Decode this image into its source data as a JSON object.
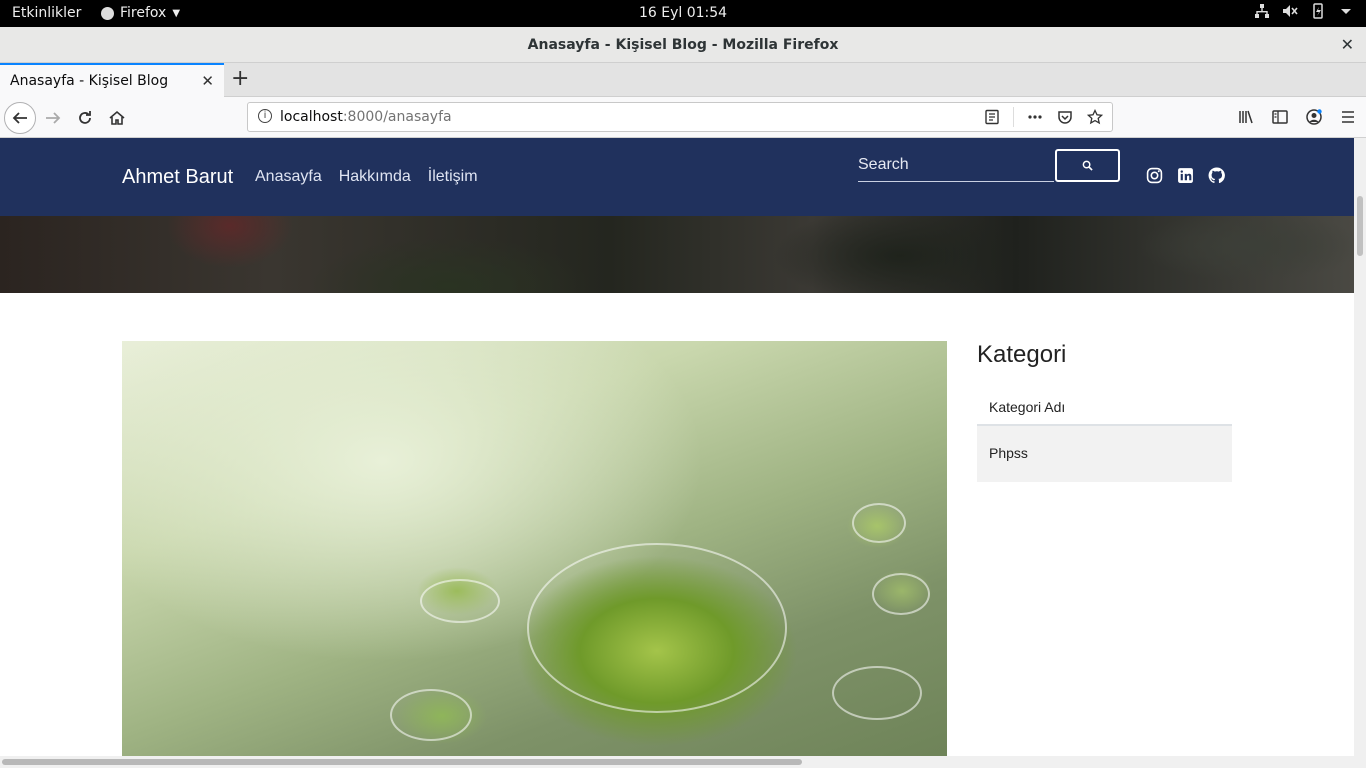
{
  "topbar": {
    "activities": "Etkinlikler",
    "app_name": "Firefox",
    "clock": "16 Eyl  01:54",
    "tray_icons": [
      "network-icon",
      "volume-muted-icon",
      "battery-icon",
      "system-menu-caret-icon"
    ]
  },
  "window": {
    "title": "Anasayfa - Kişisel Blog - Mozilla Firefox"
  },
  "tabs": [
    {
      "label": "Anasayfa - Kişisel Blog",
      "active": true
    }
  ],
  "navbar": {
    "url_host": "localhost",
    "url_rest": ":8000/anasayfa"
  },
  "site": {
    "brand": "Ahmet Barut",
    "menu": [
      "Anasayfa",
      "Hakkımda",
      "İletişim"
    ],
    "search_placeholder": "Search",
    "social_icons": [
      "instagram-icon",
      "linkedin-icon",
      "github-icon"
    ],
    "colors": {
      "navbar": "#20315d",
      "accent": "#0a84ff"
    }
  },
  "sidebar": {
    "title": "Kategori",
    "header": "Kategori Adı",
    "items": [
      "Phpss"
    ]
  }
}
